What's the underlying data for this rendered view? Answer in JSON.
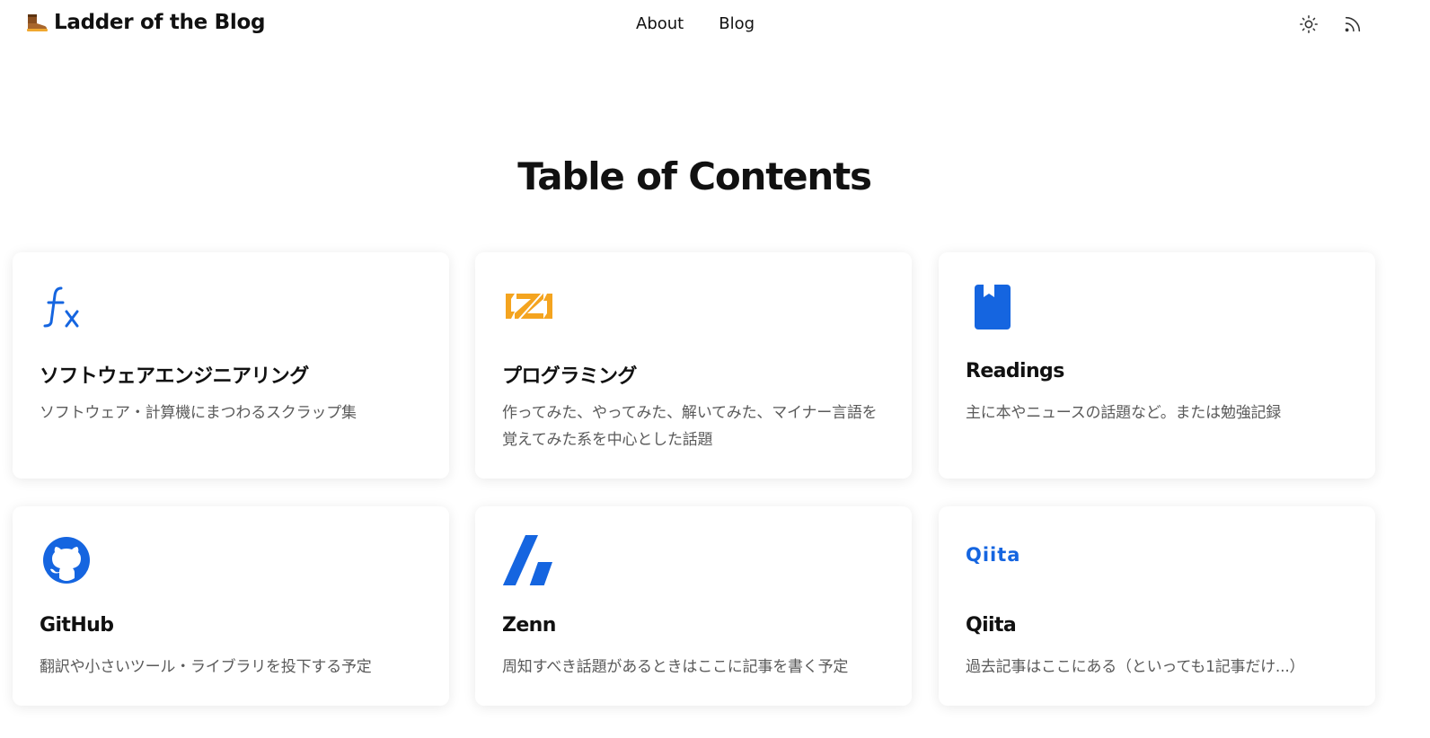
{
  "header": {
    "brand": "Ladder of the Blog",
    "brand_icon": "boot-icon",
    "nav": [
      {
        "label": "About"
      },
      {
        "label": "Blog"
      }
    ],
    "theme_icon": "sun-icon",
    "rss_icon": "rss-icon"
  },
  "page_title": "Table of Contents",
  "accent_color": "#1565e0",
  "cards": [
    {
      "icon": "function-fx-icon",
      "title": "ソフトウェアエンジニアリング",
      "desc": "ソフトウェア・計算機にまつわるスクラップ集"
    },
    {
      "icon": "zig-logo-icon",
      "title": "プログラミング",
      "desc": "作ってみた、やってみた、解いてみた、マイナー言語を覚えてみた系を中心とした話題"
    },
    {
      "icon": "book-icon",
      "title": "Readings",
      "desc": "主に本やニュースの話題など。または勉強記録"
    },
    {
      "icon": "github-icon",
      "title": "GitHub",
      "desc": "翻訳や小さいツール・ライブラリを投下する予定"
    },
    {
      "icon": "zenn-icon",
      "title": "Zenn",
      "desc": "周知すべき話題があるときはここに記事を書く予定"
    },
    {
      "icon": "qiita-icon",
      "logo_text": "Qiita",
      "title": "Qiita",
      "desc": "過去記事はここにある（といっても1記事だけ...）"
    }
  ]
}
